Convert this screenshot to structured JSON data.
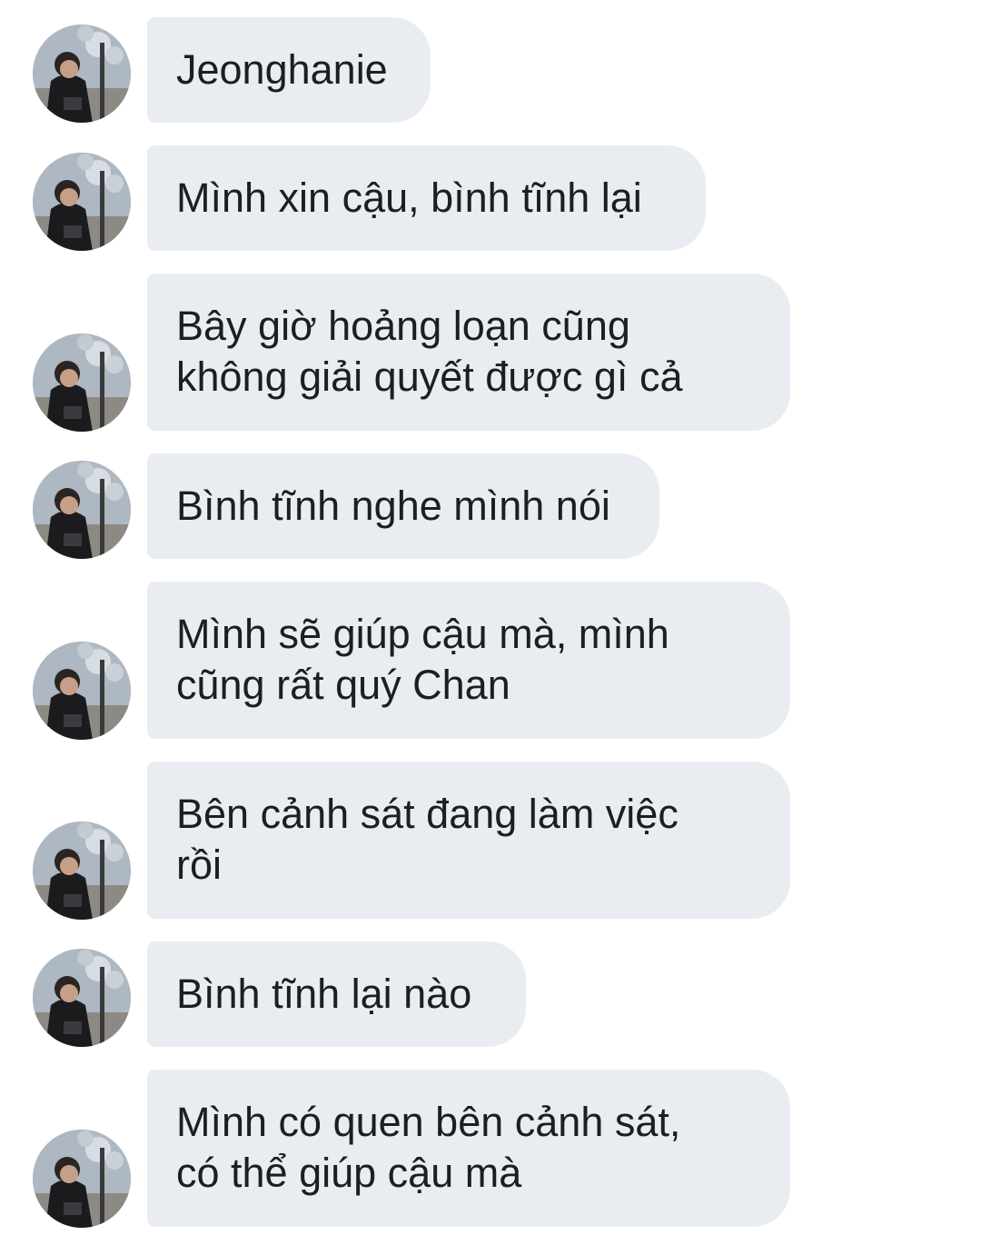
{
  "colors": {
    "bubble_bg": "#e9edf1",
    "text": "#1c1e21",
    "background": "#ffffff"
  },
  "messages": [
    {
      "lines": [
        "Jeonghanie"
      ],
      "avatar": "profile-photo-icon"
    },
    {
      "lines": [
        "Mình xin cậu, bình tĩnh lại"
      ],
      "avatar": "profile-photo-icon"
    },
    {
      "lines": [
        "Bây giờ hoảng loạn cũng",
        "không giải quyết được gì cả"
      ],
      "avatar": "profile-photo-icon"
    },
    {
      "lines": [
        "Bình tĩnh nghe mình nói"
      ],
      "avatar": "profile-photo-icon"
    },
    {
      "lines": [
        "Mình sẽ giúp cậu mà, mình",
        "cũng rất quý Chan"
      ],
      "avatar": "profile-photo-icon"
    },
    {
      "lines": [
        "Bên cảnh sát đang làm việc",
        "rồi"
      ],
      "avatar": "profile-photo-icon"
    },
    {
      "lines": [
        "Bình tĩnh lại nào"
      ],
      "avatar": "profile-photo-icon"
    },
    {
      "lines": [
        "Mình có quen bên cảnh sát,",
        "có thể giúp cậu mà"
      ],
      "avatar": "profile-photo-icon"
    }
  ]
}
